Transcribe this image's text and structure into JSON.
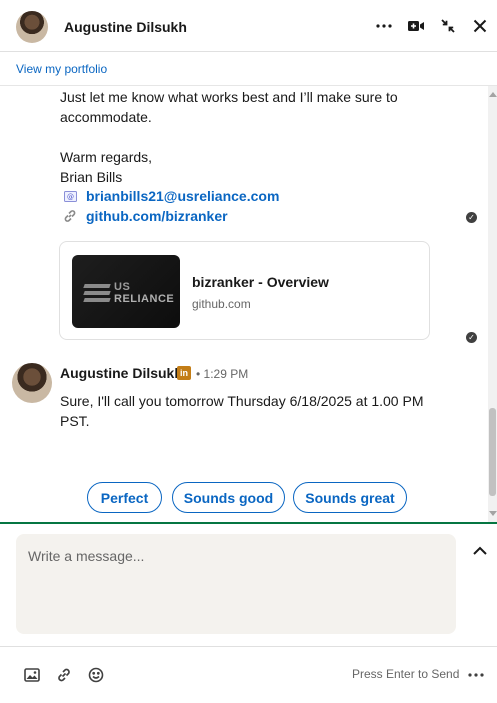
{
  "header": {
    "name": "Augustine Dilsukh"
  },
  "portfolio": {
    "link": "View my portfolio"
  },
  "message1": {
    "lines": [
      "Just let me know what works best and I’ll make sure to",
      "accommodate.",
      "Warm regards,",
      "Brian Bills"
    ],
    "email": "brianbills21@usreliance.com",
    "github": "github.com/bizranker"
  },
  "link_preview": {
    "thumb_line1": "US",
    "thumb_line2": "RELIANCE",
    "title": "bizranker - Overview",
    "domain": "github.com"
  },
  "message2": {
    "sender": "Augustine Dilsukh",
    "badge": "in",
    "time": "• 1:29 PM",
    "lines": [
      "Sure, I'll call you tomorrow Thursday 6/18/2025 at 1.00 PM",
      "PST."
    ]
  },
  "quick_replies": [
    "Perfect",
    "Sounds good",
    "Sounds great"
  ],
  "composer": {
    "placeholder": "Write a message..."
  },
  "footer": {
    "send_hint": "Press Enter to Send"
  },
  "colors": {
    "accent": "#0a66c2",
    "divider": "#057642",
    "linkedin_badge": "#c37d16"
  }
}
